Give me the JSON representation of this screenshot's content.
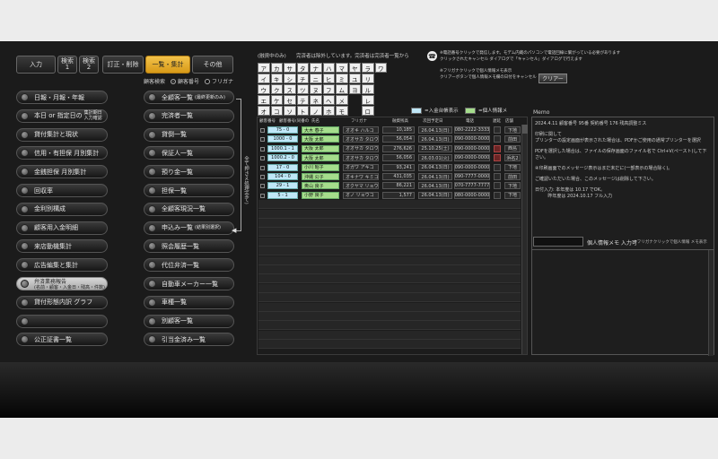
{
  "tabs": [
    {
      "label": "入力",
      "active": false
    },
    {
      "label": "検索\n1",
      "active": false
    },
    {
      "label": "検索\n2",
      "active": false
    },
    {
      "label": "訂正・削除",
      "active": false
    },
    {
      "label": "一覧・集計",
      "active": true
    },
    {
      "label": "その他",
      "active": false
    }
  ],
  "search_mode": {
    "label": "顧客検索",
    "options": [
      "顧客番号",
      "フリガナ"
    ],
    "selected": "顧客番号"
  },
  "left_menu": [
    {
      "label": "日報・月報・年報"
    },
    {
      "label": "本日 or 指定日の",
      "sub": "集計期日\n入力確認"
    },
    {
      "label": "貸付集計と現状"
    },
    {
      "label": "信用・有担保 月別集計"
    },
    {
      "label": "金銭担保 月別集計"
    },
    {
      "label": "回収率"
    },
    {
      "label": "金利別構成"
    },
    {
      "label": "顧客用入金明細"
    },
    {
      "label": "来店動機集計"
    },
    {
      "label": "広告編集と集計"
    },
    {
      "label": "弁済業務報告",
      "sub2": "(名前・顧客・入金日・残高・件数)",
      "light": true
    },
    {
      "label": "貸付形態内訳 グラフ"
    },
    {
      "label": ""
    },
    {
      "label": "公正証書一覧"
    }
  ],
  "right_menu": [
    {
      "label": "全顧客一覧",
      "sub": "(最終更新のみ)"
    },
    {
      "label": "完済者一覧"
    },
    {
      "label": "貸倒一覧"
    },
    {
      "label": "保証人一覧"
    },
    {
      "label": "預り金一覧"
    },
    {
      "label": "担保一覧"
    },
    {
      "label": "全顧客現況一覧"
    },
    {
      "label": "申込み一覧",
      "sub": "(結果別選択)"
    },
    {
      "label": "照会履歴一覧"
    },
    {
      "label": "代位弁済一覧"
    },
    {
      "label": "自動車メーカー一覧"
    },
    {
      "label": "車種一覧"
    },
    {
      "label": "別顧客一覧"
    },
    {
      "label": "引当金済み一覧"
    }
  ],
  "vertical_label": "全て押さえ処理(全て)",
  "notes": {
    "kana_header": "(融資中のみ)",
    "kana_hint": "完済者は除外しています。完済者は完済者一覧から",
    "phone_note1": "※電話番号クリックで発信します。モデム内蔵のパソコンで電話回線に繋がっている必要があります",
    "phone_note2": "クリックされたキャンセル ダイアログで「キャンセル」ダイアログで行えます",
    "kana_note1": "※フリガナクリックで個人情報メモ表示",
    "kana_note2": "クリアーボタンで個人情報メモ欄の日付をキャンセル"
  },
  "clear_button": "クリアー",
  "kana_rows": [
    [
      "ア",
      "カ",
      "サ",
      "タ",
      "ナ",
      "ハ",
      "マ",
      "ヤ",
      "ラ",
      "ワ"
    ],
    [
      "イ",
      "キ",
      "シ",
      "チ",
      "ニ",
      "ヒ",
      "ミ",
      "ユ",
      "リ",
      ""
    ],
    [
      "ウ",
      "ク",
      "ス",
      "ツ",
      "ヌ",
      "フ",
      "ム",
      "ヨ",
      "ル",
      ""
    ],
    [
      "エ",
      "ケ",
      "セ",
      "テ",
      "ネ",
      "ヘ",
      "メ",
      "",
      "レ",
      ""
    ],
    [
      "オ",
      "コ",
      "ソ",
      "ト",
      "ノ",
      "ホ",
      "モ",
      "",
      "ロ",
      ""
    ]
  ],
  "legend": [
    {
      "label": "=入金台帳表示",
      "color": "#bfe7f7"
    },
    {
      "label": "=個人情報メ",
      "color": "#a5dd8c"
    }
  ],
  "table": {
    "headers": [
      "顧客番号",
      "顧客番号(同番の",
      "氏名",
      "フリガナ",
      "融資残高",
      "次回予定日",
      "電話",
      "遅延",
      "店舗"
    ],
    "rows": [
      {
        "num": "75 - 0",
        "name": "大木 春子",
        "kana": "オオキ ハルコ",
        "amount": "10,185",
        "date": "26.04.13(日)",
        "tel": "080-2222-3333",
        "red": false,
        "branch": "下地"
      },
      {
        "num": "1000 - 0",
        "name": "大阪 太郎",
        "kana": "オオサカ タロウ",
        "amount": "56,054",
        "date": "26.04.13(日)",
        "tel": "090-0000-0000",
        "red": false,
        "branch": "前田"
      },
      {
        "num": "1000.1 - 1",
        "name": "大阪 太郎",
        "kana": "オオサカ タロウ",
        "amount": "276,626",
        "date": "25.10.25(土)",
        "tel": "090-0000-0000",
        "red": true,
        "branch": "西島"
      },
      {
        "num": "1000.2 - 0",
        "name": "大阪 太郎",
        "kana": "オオサカ タロウ",
        "amount": "56,056",
        "date": "26.03.01(火)",
        "tel": "090-0000-0000",
        "red": true,
        "branch": "浜名2"
      },
      {
        "num": "17 - 0",
        "name": "小川 昭子",
        "kana": "オガワ アキコ",
        "amount": "93,241",
        "date": "26.04.13(日)",
        "tel": "090-0000-0000",
        "red": false,
        "branch": "下地"
      },
      {
        "num": "104 - 0",
        "name": "沖縄 公子",
        "kana": "オキナワ キミコ",
        "amount": "431,035",
        "date": "26.04.13(日)",
        "tel": "090-7777-0000",
        "red": false,
        "branch": "前田"
      },
      {
        "num": "29 - 1",
        "name": "奥山 良子",
        "kana": "オクヤマ リョウ",
        "amount": "86,221",
        "date": "26.04.13(日)",
        "tel": "070-7777-7777",
        "red": false,
        "branch": "下地"
      },
      {
        "num": "5 - 1",
        "name": "小野 良子",
        "kana": "オノ リョウコ",
        "amount": "1,577",
        "date": "26.04.13(日)",
        "tel": "080-0000-0000",
        "red": false,
        "branch": "下地"
      }
    ]
  },
  "memo": {
    "title": "Memo",
    "lines": [
      "2024.4.11 顧客番号 95番 契約番号 176 残高調整ミス",
      "",
      "印刷に関して",
      "プリンターの設定画面が表示された場合は、PDFかご使用の通常プリンターを選択",
      "",
      "PDFを選択した場合は、ファイルの保存画面のファイル名で Ctrl+V(ペースト)して下さい。",
      "",
      "④印刷画面でのメッセージ表示はまだ未だに(一部表示の場合除く)。",
      "",
      "ご確認いただいた場合、このメッセージは削除して下さい。",
      "",
      "日付入力: 本年度は 10.17 でOK。",
      "         昨年度は 2024.10.17 フル入力"
    ]
  },
  "memo_input": {
    "label": "個人情報メモ 入力可",
    "note": "※フリガナクリックで個人情報 メモ表示"
  }
}
